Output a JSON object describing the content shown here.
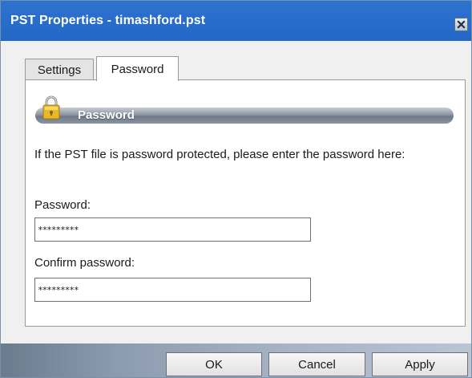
{
  "window": {
    "title": "PST Properties - timashford.pst",
    "close_icon": "close-icon"
  },
  "tabs": [
    {
      "label": "Settings",
      "selected": false
    },
    {
      "label": "Password",
      "selected": true
    }
  ],
  "section": {
    "title": "Password",
    "icon": "lock-icon",
    "description": "If the PST file is password protected, please enter the password here:"
  },
  "fields": {
    "password_label": "Password:",
    "password_value": "*********",
    "confirm_label": "Confirm password:",
    "confirm_value": "*********"
  },
  "buttons": {
    "ok": "OK",
    "cancel": "Cancel",
    "apply": "Apply"
  },
  "colors": {
    "titlebar": "#2368c6",
    "dialog_bg": "#f0f0f0",
    "section_bar": "#8d96a3"
  }
}
